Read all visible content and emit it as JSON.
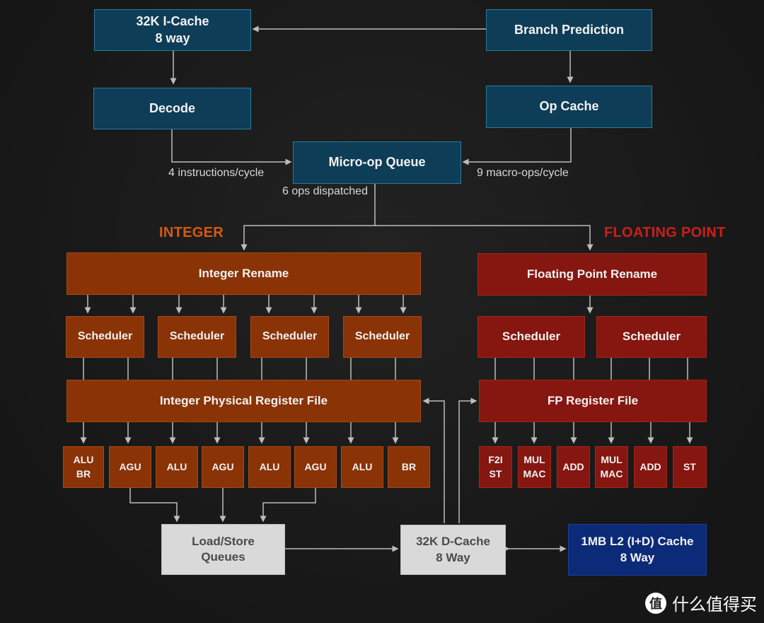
{
  "diagram": {
    "frontend": {
      "icache": "32K I-Cache\n8 way",
      "branch_prediction": "Branch Prediction",
      "decode": "Decode",
      "op_cache": "Op Cache",
      "micro_op_queue": "Micro-op Queue",
      "decode_rate": "4 instructions/cycle",
      "op_cache_rate": "9 macro-ops/cycle",
      "dispatch_rate": "6 ops dispatched"
    },
    "integer": {
      "section_title": "INTEGER",
      "rename": "Integer Rename",
      "schedulers": [
        "Scheduler",
        "Scheduler",
        "Scheduler",
        "Scheduler"
      ],
      "register_file": "Integer Physical Register File",
      "units": [
        "ALU\nBR",
        "AGU",
        "ALU",
        "AGU",
        "ALU",
        "AGU",
        "ALU",
        "BR"
      ]
    },
    "floating_point": {
      "section_title": "FLOATING POINT",
      "rename": "Floating Point Rename",
      "schedulers": [
        "Scheduler",
        "Scheduler"
      ],
      "register_file": "FP Register File",
      "units": [
        "F2I\nST",
        "MUL\nMAC",
        "ADD",
        "MUL\nMAC",
        "ADD",
        "ST"
      ]
    },
    "memory": {
      "load_store": "Load/Store\nQueues",
      "dcache": "32K D-Cache\n8 Way",
      "l2cache": "1MB L2 (I+D) Cache\n8 Way"
    },
    "colors": {
      "frontend": "#0e3d57",
      "integer": "#8a3306",
      "floating_point": "#861610",
      "memory": "#d9d9d9",
      "l2": "#0b2a78",
      "integer_title": "#d9580f",
      "fp_title": "#cc1f1a"
    }
  },
  "watermark": {
    "icon_glyph": "值",
    "text": "什么值得买"
  }
}
